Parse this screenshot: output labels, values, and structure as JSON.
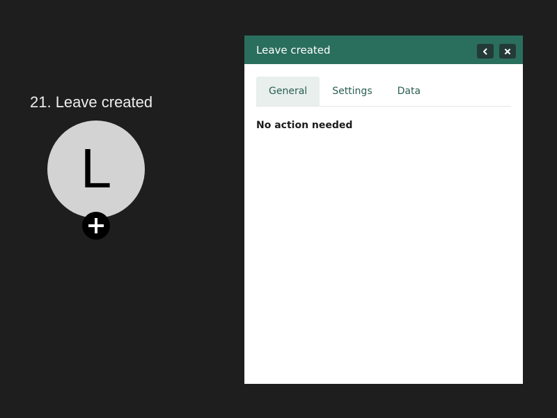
{
  "theme": {
    "accent": "#2a6e5e",
    "background": "#1e1e1e"
  },
  "node": {
    "title": "21. Leave created",
    "letter": "L",
    "add_icon": "plus-icon"
  },
  "panel": {
    "title": "Leave created",
    "back_icon": "chevron-left-icon",
    "close_icon": "close-icon",
    "tabs": [
      {
        "label": "General",
        "active": true
      },
      {
        "label": "Settings",
        "active": false
      },
      {
        "label": "Data",
        "active": false
      }
    ],
    "status": "No action needed"
  }
}
